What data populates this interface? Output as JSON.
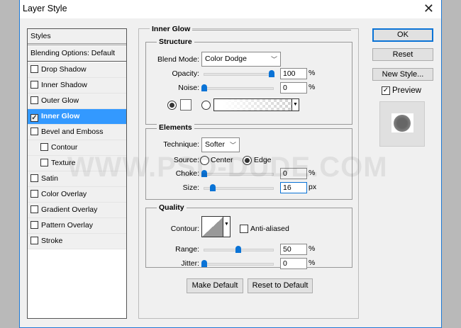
{
  "window": {
    "title": "Layer Style",
    "close_icon": "close-icon"
  },
  "sidebar": {
    "header": "Styles",
    "blending": "Blending Options: Default",
    "items": [
      {
        "label": "Drop Shadow",
        "checked": false,
        "indent": false
      },
      {
        "label": "Inner Shadow",
        "checked": false,
        "indent": false
      },
      {
        "label": "Outer Glow",
        "checked": false,
        "indent": false
      },
      {
        "label": "Inner Glow",
        "checked": true,
        "indent": false,
        "selected": true
      },
      {
        "label": "Bevel and Emboss",
        "checked": false,
        "indent": false
      },
      {
        "label": "Contour",
        "checked": false,
        "indent": true
      },
      {
        "label": "Texture",
        "checked": false,
        "indent": true
      },
      {
        "label": "Satin",
        "checked": false,
        "indent": false
      },
      {
        "label": "Color Overlay",
        "checked": false,
        "indent": false
      },
      {
        "label": "Gradient Overlay",
        "checked": false,
        "indent": false
      },
      {
        "label": "Pattern Overlay",
        "checked": false,
        "indent": false
      },
      {
        "label": "Stroke",
        "checked": false,
        "indent": false
      }
    ]
  },
  "main": {
    "title": "Inner Glow",
    "structure": {
      "title": "Structure",
      "blend_mode_label": "Blend Mode:",
      "blend_mode": "Color Dodge",
      "opacity_label": "Opacity:",
      "opacity": "100",
      "opacity_pct": 100,
      "noise_label": "Noise:",
      "noise": "0",
      "noise_pct": 0,
      "unit": "%"
    },
    "elements": {
      "title": "Elements",
      "technique_label": "Technique:",
      "technique": "Softer",
      "source_label": "Source:",
      "source_center": "Center",
      "source_edge": "Edge",
      "choke_label": "Choke:",
      "choke": "0",
      "choke_pct": 0,
      "size_label": "Size:",
      "size": "16",
      "size_fraction": 0.065,
      "pct": "%",
      "px": "px"
    },
    "quality": {
      "title": "Quality",
      "contour_label": "Contour:",
      "anti_aliased": "Anti-aliased",
      "range_label": "Range:",
      "range": "50",
      "range_pct": 50,
      "jitter_label": "Jitter:",
      "jitter": "0",
      "jitter_pct": 0,
      "unit": "%"
    },
    "make_default": "Make Default",
    "reset_default": "Reset to Default"
  },
  "right": {
    "ok": "OK",
    "reset": "Reset",
    "new_style": "New Style...",
    "preview": "Preview"
  },
  "watermark": "WWW.PSD-DUDE.COM",
  "colors": {
    "accent": "#3399ff",
    "slider": "#0a73d6"
  }
}
